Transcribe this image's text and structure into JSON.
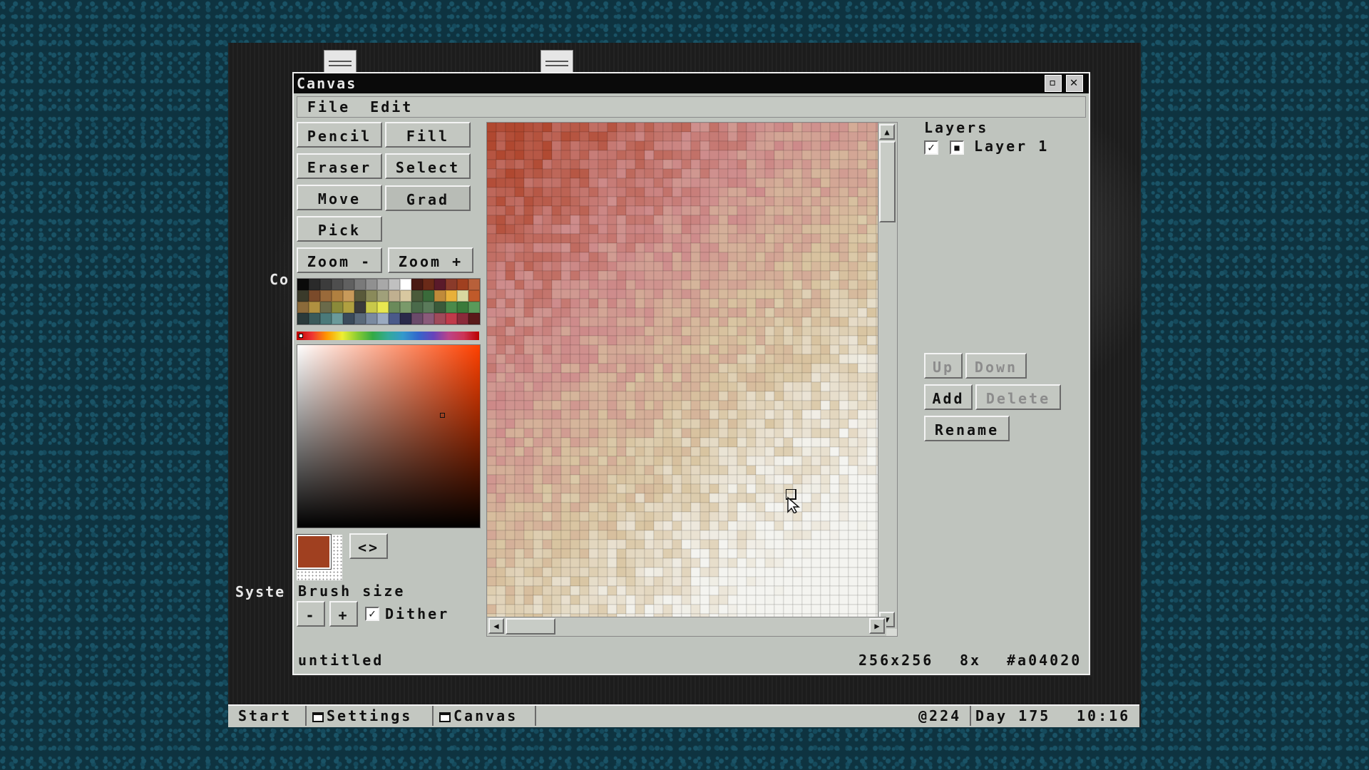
{
  "window": {
    "title": "Canvas",
    "menu": [
      "File",
      "Edit"
    ]
  },
  "tools": {
    "pencil": "Pencil",
    "fill": "Fill",
    "eraser": "Eraser",
    "select": "Select",
    "move": "Move",
    "grad": "Grad",
    "pick": "Pick",
    "zoom_out": "Zoom -",
    "zoom_in": "Zoom +",
    "swap": "<>"
  },
  "palette": {
    "swatches": [
      "#0a0a0a",
      "#2a2a2a",
      "#3c3c3c",
      "#4e4e4e",
      "#606060",
      "#7a7a7a",
      "#909090",
      "#a8a8a8",
      "#c0c0c0",
      "#ffffff",
      "#4a1a14",
      "#6a2a18",
      "#5a1a2a",
      "#8a3a2a",
      "#a04020",
      "#b8603a",
      "#3a3a2a",
      "#7a4a2a",
      "#9a6a3a",
      "#b08040",
      "#c89a5a",
      "#5a5a3a",
      "#8a8a5a",
      "#a0a07a",
      "#c0b090",
      "#d8c8a0",
      "#4a5a3a",
      "#3a6a3a",
      "#c08a3a",
      "#e8b03a",
      "#d8d8a0",
      "#c05a2a",
      "#8a6a3a",
      "#b09040",
      "#6a6a4a",
      "#8a8a3a",
      "#b0a040",
      "#3a3a3a",
      "#c8c84a",
      "#e8e850",
      "#6a8a5a",
      "#7a9a6a",
      "#4a6a4a",
      "#5a7a5a",
      "#3a5a3a",
      "#4a8a4a",
      "#3a7a3a",
      "#5a9a5a",
      "#2a3a3a",
      "#3a5a5a",
      "#4a7a7a",
      "#6a9a9a",
      "#3a4a5a",
      "#5a6a7a",
      "#7a8aa0",
      "#9aaac0",
      "#4a5a8a",
      "#2a2a4a",
      "#6a4a6a",
      "#8a5a7a",
      "#a04a5a",
      "#c03a4a",
      "#8a2a3a",
      "#5a1a1a"
    ],
    "current_color": "#a04020"
  },
  "brush": {
    "label": "Brush size",
    "minus": "-",
    "plus": "+",
    "dither_label": "Dither",
    "dither_checked": true
  },
  "layers": {
    "title": "Layers",
    "items": [
      {
        "name": "Layer 1",
        "visible": true
      }
    ],
    "up": "Up",
    "down": "Down",
    "add": "Add",
    "delete": "Delete",
    "rename": "Rename"
  },
  "status": {
    "filename": "untitled",
    "size": "256x256",
    "zoom": "8x",
    "color": "#a04020"
  },
  "desktop": {
    "label_left": "Co",
    "label_system": "Syste"
  },
  "taskbar": {
    "start": "Start",
    "tasks": [
      "Settings",
      "Canvas"
    ],
    "money": "@224",
    "day": "Day 175",
    "time": "10:16"
  }
}
